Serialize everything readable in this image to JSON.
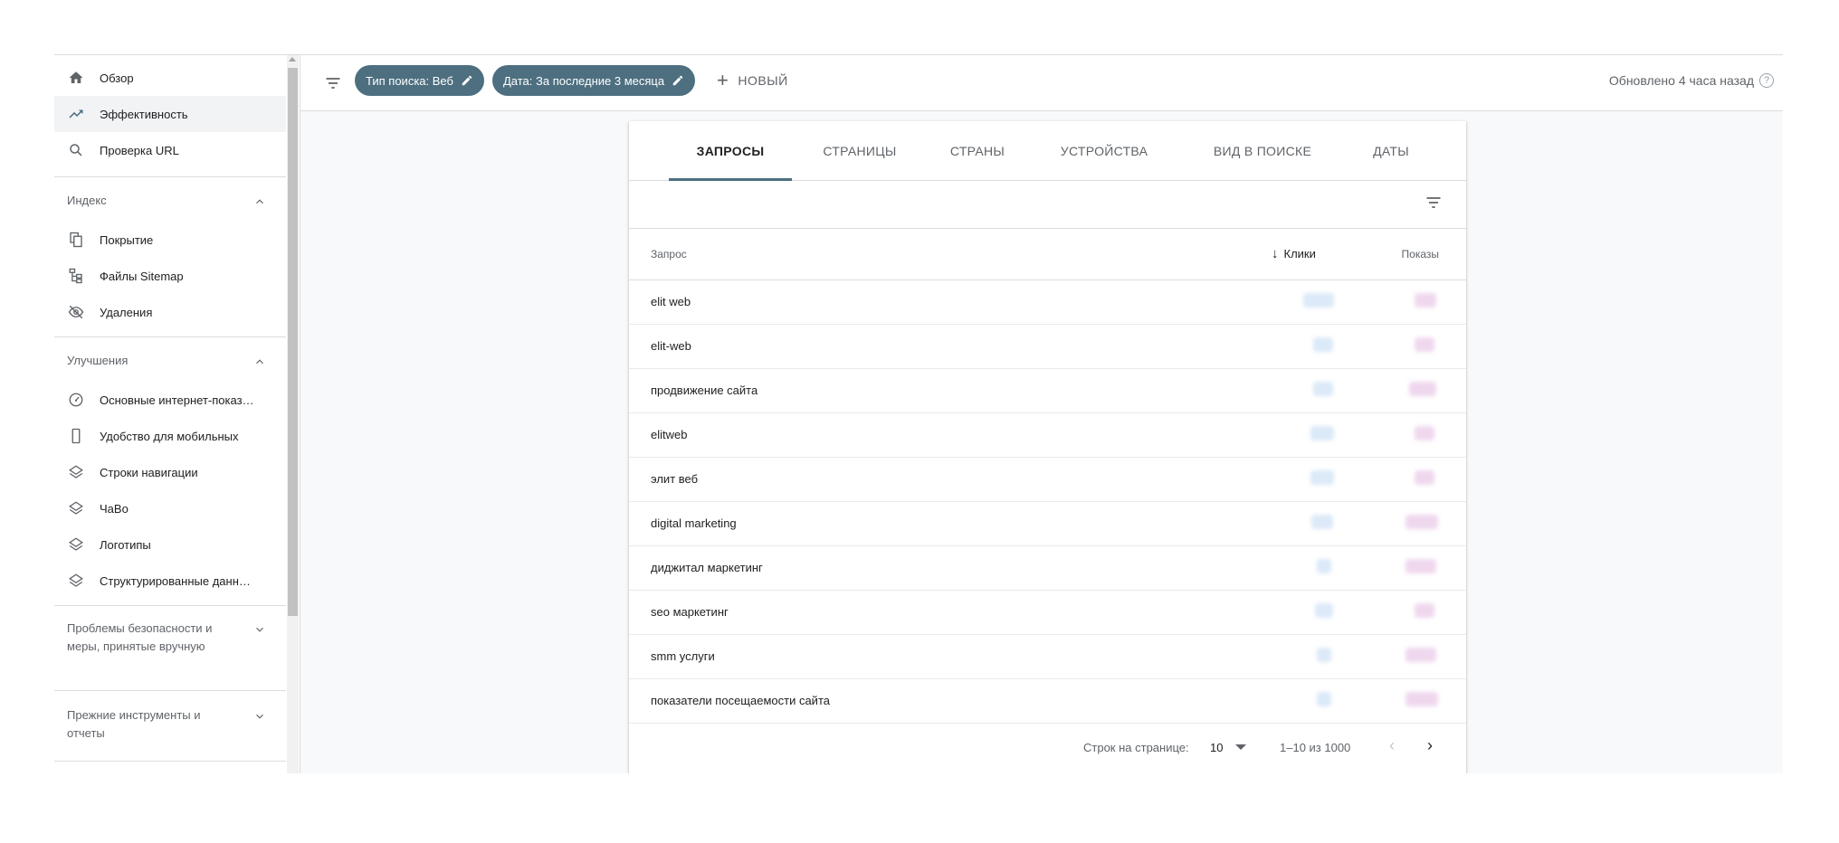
{
  "sidebar": {
    "top_items": [
      {
        "label": "Обзор",
        "icon": "home-icon"
      },
      {
        "label": "Эффективность",
        "icon": "trending-up-icon",
        "active": true
      },
      {
        "label": "Проверка URL",
        "icon": "search-icon"
      }
    ],
    "sections": [
      {
        "title": "Индекс",
        "expanded": true,
        "items": [
          {
            "label": "Покрытие",
            "icon": "copy-icon"
          },
          {
            "label": "Файлы Sitemap",
            "icon": "sitemap-icon"
          },
          {
            "label": "Удаления",
            "icon": "eye-off-icon"
          }
        ]
      },
      {
        "title": "Улучшения",
        "expanded": true,
        "items": [
          {
            "label": "Основные интернет-показ…",
            "icon": "gauge-icon"
          },
          {
            "label": "Удобство для мобильных",
            "icon": "phone-icon"
          },
          {
            "label": "Строки навигации",
            "icon": "layers-icon"
          },
          {
            "label": "ЧаВо",
            "icon": "layers-icon"
          },
          {
            "label": "Логотипы",
            "icon": "layers-icon"
          },
          {
            "label": "Структурированные данн…",
            "icon": "layers-icon"
          }
        ]
      },
      {
        "title": "Проблемы безопасности и меры, принятые вручную",
        "expanded": false
      },
      {
        "title": "Прежние инструменты и отчеты",
        "expanded": false
      }
    ]
  },
  "toolbar": {
    "chips": [
      {
        "label": "Тип поиска: Веб"
      },
      {
        "label": "Дата: За последние 3 месяца"
      }
    ],
    "new_label": "НОВЫЙ",
    "updated_label": "Обновлено 4 часа назад"
  },
  "tabs": [
    "ЗАПРОСЫ",
    "СТРАНИЦЫ",
    "СТРАНЫ",
    "УСТРОЙСТВА",
    "ВИД В ПОИСКЕ",
    "ДАТЫ"
  ],
  "table": {
    "col_query": "Запрос",
    "col_clicks": "Клики",
    "col_impressions": "Показы",
    "rows": [
      {
        "query": "elit web"
      },
      {
        "query": "elit-web"
      },
      {
        "query": "продвижение сайта"
      },
      {
        "query": "elitweb"
      },
      {
        "query": "элит веб"
      },
      {
        "query": "digital marketing"
      },
      {
        "query": "диджитал маркетинг"
      },
      {
        "query": "seo маркетинг"
      },
      {
        "query": "smm услуги"
      },
      {
        "query": "показатели посещаемости сайта"
      }
    ]
  },
  "pagination": {
    "rows_per_page_label": "Строк на странице:",
    "rows_per_page_value": "10",
    "range_label": "1–10 из 1000"
  },
  "colors": {
    "accent": "#4d6f80",
    "active_bg": "#f1f3f4"
  }
}
